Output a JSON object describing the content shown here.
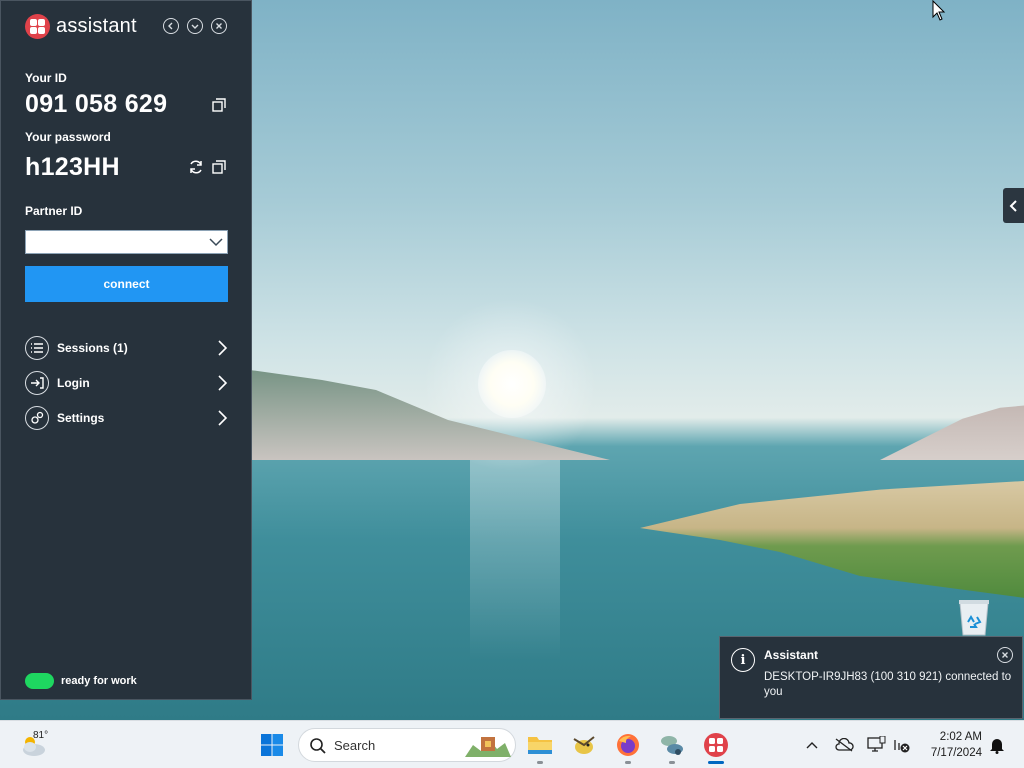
{
  "assistant": {
    "app_name": "assistant",
    "your_id_label": "Your ID",
    "your_id": "091 058 629",
    "password_label": "Your password",
    "password": "h123HH",
    "partner_label": "Partner ID",
    "partner_value": "",
    "connect_label": "connect",
    "menu": [
      {
        "label": "Sessions (1)",
        "icon": "list-icon"
      },
      {
        "label": "Login",
        "icon": "login-icon"
      },
      {
        "label": "Settings",
        "icon": "gear-icon"
      }
    ],
    "status_text": "ready for work",
    "status_color": "#1ed760",
    "accent_color": "#2196f3"
  },
  "toast": {
    "title": "Assistant",
    "message": "DESKTOP-IR9JH83 (100 310 921) connected to you"
  },
  "taskbar": {
    "weather_temp": "81°",
    "search_placeholder": "Search",
    "apps": [
      "start-icon",
      "search-icon",
      "file-explorer-icon",
      "bird-app-icon",
      "firefox-icon",
      "network-app-icon",
      "assistant-icon"
    ],
    "time": "2:02 AM",
    "date": "7/17/2024"
  }
}
